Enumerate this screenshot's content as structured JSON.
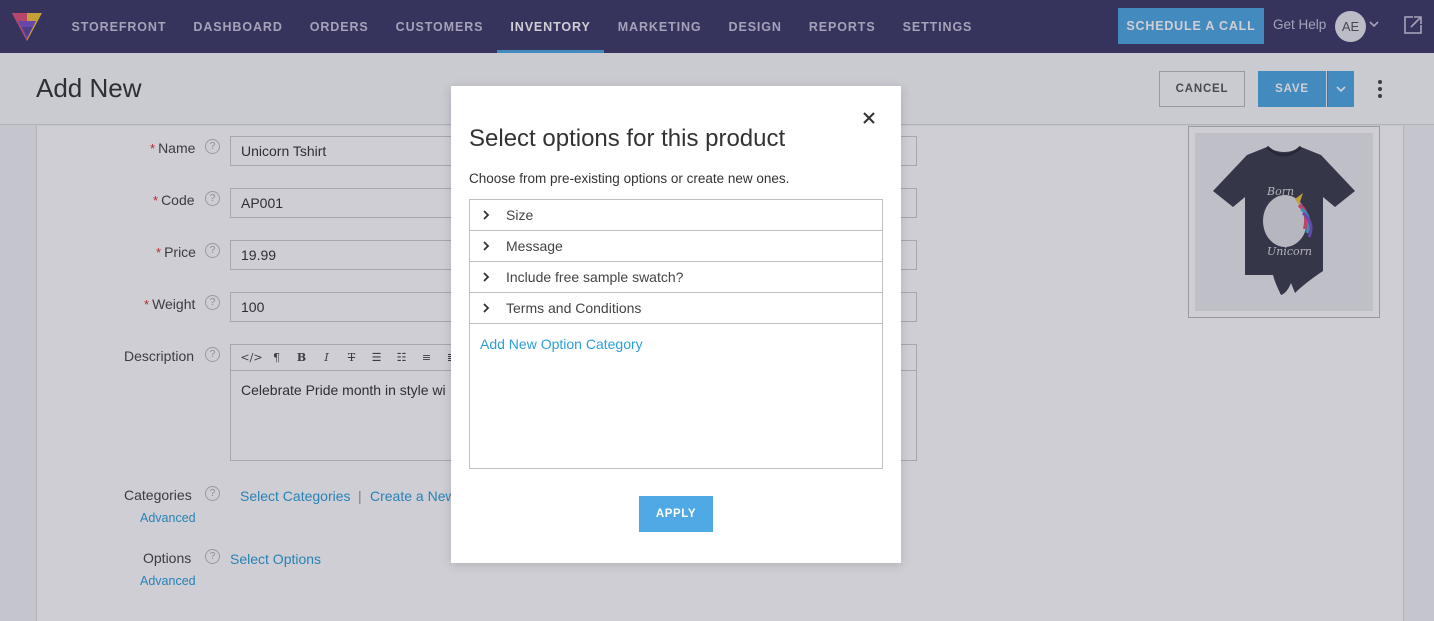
{
  "nav": {
    "items": [
      "STOREFRONT",
      "DASHBOARD",
      "ORDERS",
      "CUSTOMERS",
      "INVENTORY",
      "MARKETING",
      "DESIGN",
      "REPORTS",
      "SETTINGS"
    ],
    "active": "INVENTORY",
    "schedule_label": "SCHEDULE A CALL",
    "help_label": "Get Help",
    "avatar_initials": "AE"
  },
  "header": {
    "title": "Add New",
    "cancel_label": "CANCEL",
    "save_label": "SAVE"
  },
  "form": {
    "name_label": "Name",
    "name_value": "Unicorn Tshirt",
    "code_label": "Code",
    "code_value": "AP001",
    "price_label": "Price",
    "price_value": "19.99",
    "weight_label": "Weight",
    "weight_value": "100",
    "description_label": "Description",
    "description_value": "Celebrate Pride month in style wi",
    "categories_label": "Categories",
    "select_categories": "Select Categories",
    "separator": "|",
    "create_new": "Create a New",
    "advanced_label": "Advanced",
    "options_label": "Options",
    "select_options": "Select Options"
  },
  "modal": {
    "title": "Select options for this product",
    "subtitle": "Choose from pre-existing options or create new ones.",
    "options": [
      "Size",
      "Message",
      "Include free sample swatch?",
      "Terms and Conditions"
    ],
    "add_category": "Add New Option Category",
    "apply_label": "APPLY"
  },
  "colors": {
    "nav_bg": "#3d3a67",
    "accent": "#4ea9e4",
    "link": "#2d9fd8",
    "required": "#d9342b"
  }
}
